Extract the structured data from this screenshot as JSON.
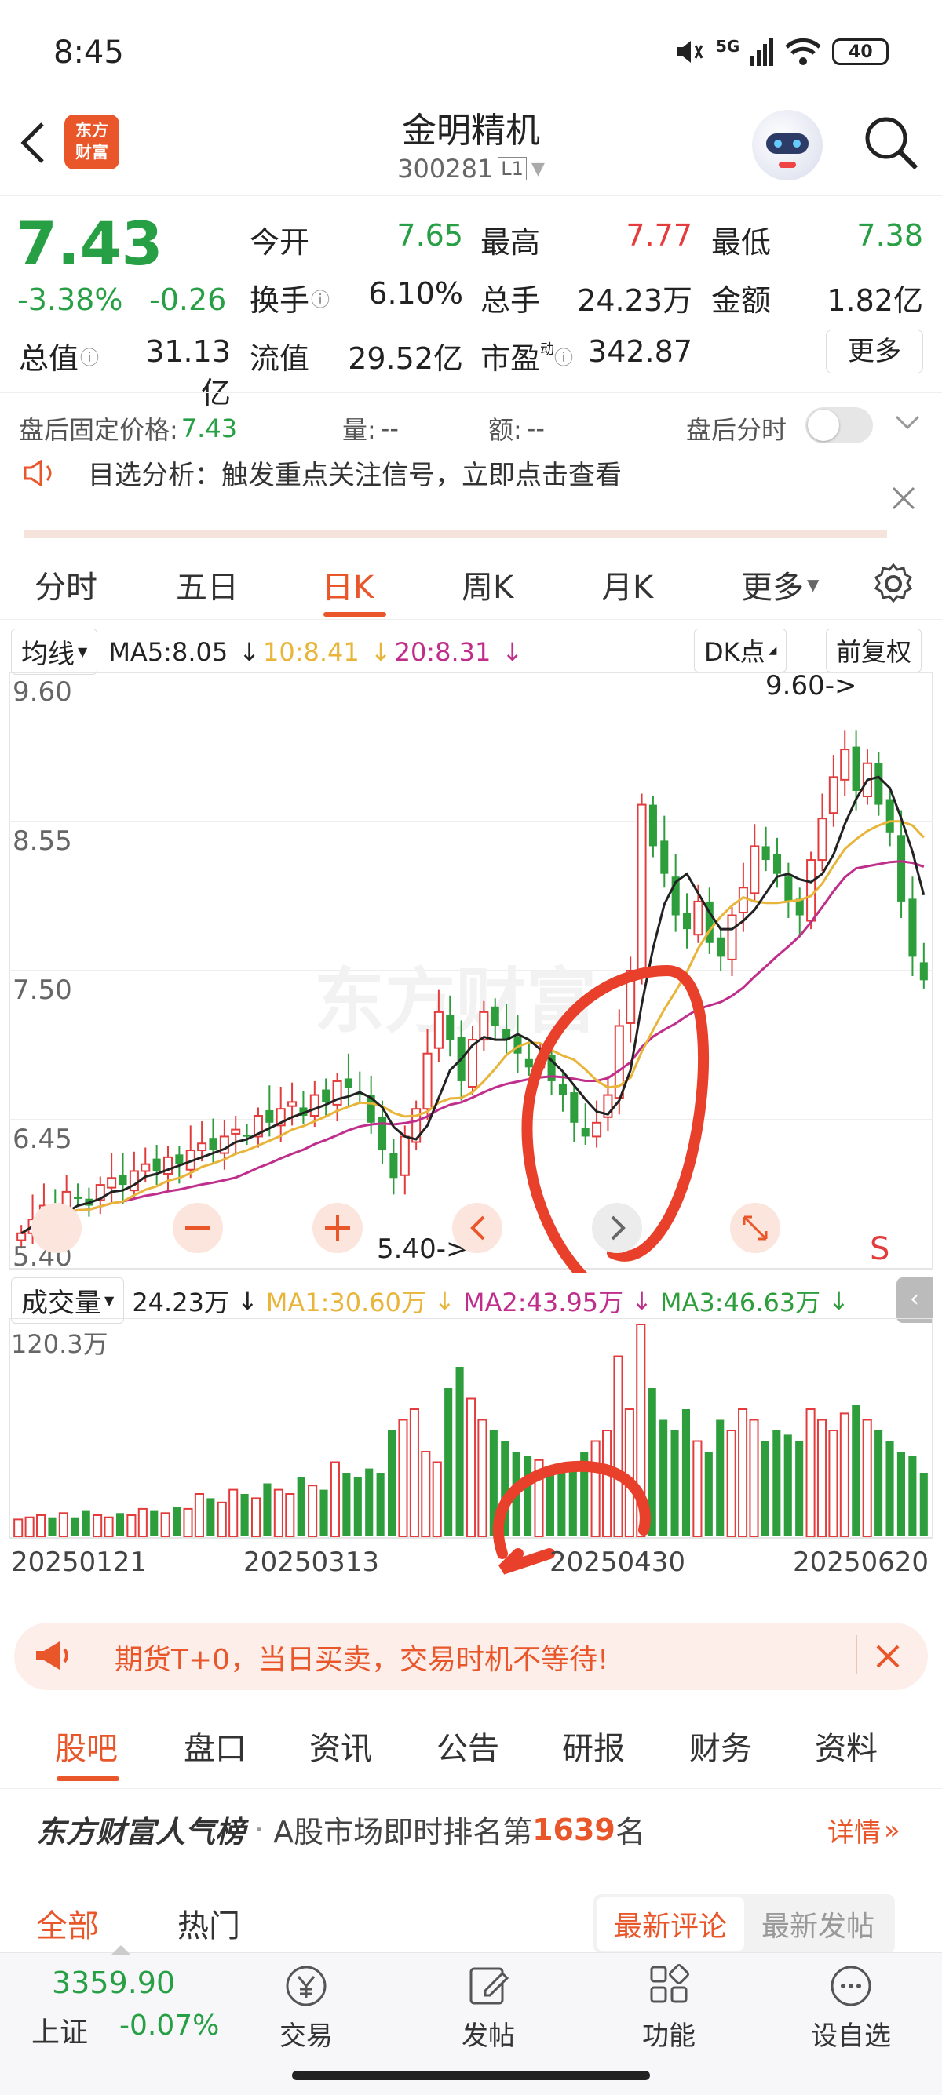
{
  "status_bar": {
    "time": "8:45",
    "network": "5G",
    "battery": "40"
  },
  "header": {
    "title": "金明精机",
    "code": "300281",
    "level": "L1",
    "brand": "东方\n财富"
  },
  "quote": {
    "price": "7.43",
    "change_pct": "-3.38%",
    "change": "-0.26",
    "open_label": "今开",
    "open": "7.65",
    "high_label": "最高",
    "high": "7.77",
    "low_label": "最低",
    "low": "7.38",
    "turnover_label": "换手",
    "turnover": "6.10%",
    "volume_label": "总手",
    "volume": "24.23万",
    "amount_label": "金额",
    "amount": "1.82亿",
    "mktcap_label": "总值",
    "mktcap": "31.13亿",
    "float_label": "流值",
    "float": "29.52亿",
    "pe_label": "市盈",
    "pe_sup": "动",
    "pe": "342.87",
    "more_label": "更多"
  },
  "after_hours": {
    "price_label": "盘后固定价格:",
    "price": "7.43",
    "vol_label": "量:",
    "vol": "--",
    "amt_label": "额:",
    "amt": "--",
    "toggle_label": "盘后分时"
  },
  "notice": {
    "text": "目选分析：触发重点关注信号，立即点击查看"
  },
  "period_tabs": [
    "分时",
    "五日",
    "日K",
    "周K",
    "月K",
    "更多"
  ],
  "period_active": 2,
  "kline_bar": {
    "ma_selector": "均线",
    "ma5": "MA5:8.05",
    "ma10": "10:8.41",
    "ma20": "20:8.31",
    "dk": "DK点",
    "adjust": "前复权",
    "watermark": "东方财富"
  },
  "kline_axis": {
    "y1": "9.60",
    "y2": "8.55",
    "y3": "7.50",
    "y4": "6.45",
    "y5": "5.40"
  },
  "kline_marks": {
    "high_label": "9.60->",
    "low_label": "5.40->",
    "sell_marker": "S"
  },
  "volume_bar": {
    "selector": "成交量",
    "value": "24.23万",
    "ma1": "MA1:30.60万",
    "ma2": "MA2:43.95万",
    "ma3": "MA3:46.63万",
    "max_label": "120.3万"
  },
  "dates": [
    "20250121",
    "20250313",
    "20250430",
    "20250620"
  ],
  "colors": {
    "up": "#e43c3c",
    "down": "#2e9d3c",
    "accent": "#e8562a",
    "ma5": "#222222",
    "ma10": "#e8b53a",
    "ma20": "#c02e8c"
  },
  "chart_data": {
    "type": "candlestick",
    "title": "",
    "ylim": [
      5.4,
      9.6
    ],
    "y_ticks": [
      9.6,
      8.55,
      7.5,
      6.45,
      5.4
    ],
    "x_ticks": [
      "20250121",
      "20250313",
      "20250430",
      "20250620"
    ],
    "high_mark": 9.6,
    "low_mark": 5.4,
    "ma_values_latest": {
      "MA5": 8.05,
      "MA10": 8.41,
      "MA20": 8.31
    },
    "close_series": [
      5.6,
      5.7,
      5.8,
      5.75,
      5.9,
      5.85,
      5.8,
      5.95,
      6.0,
      5.95,
      6.05,
      6.1,
      6.05,
      6.15,
      6.1,
      6.2,
      6.25,
      6.2,
      6.3,
      6.35,
      6.3,
      6.45,
      6.4,
      6.5,
      6.55,
      6.45,
      6.6,
      6.55,
      6.7,
      6.65,
      6.6,
      6.4,
      6.2,
      6.0,
      6.3,
      6.5,
      6.9,
      7.2,
      7.0,
      6.7,
      7.0,
      7.2,
      7.1,
      7.0,
      6.9,
      6.8,
      6.85,
      6.7,
      6.6,
      6.4,
      6.3,
      6.4,
      6.6,
      7.1,
      7.5,
      8.7,
      8.4,
      8.2,
      7.9,
      7.8,
      8.0,
      7.7,
      7.6,
      7.9,
      8.1,
      8.4,
      8.3,
      8.2,
      8.0,
      7.9,
      8.3,
      8.6,
      8.9,
      9.1,
      8.8,
      9.0,
      8.7,
      8.5,
      8.0,
      7.6,
      7.43
    ],
    "volume": {
      "max_label": 1203000,
      "latest": 242300,
      "MA1": 306000,
      "MA2": 439500,
      "MA3": 466300,
      "values": [
        8,
        9,
        10,
        9,
        11,
        9,
        12,
        10,
        9,
        11,
        10,
        13,
        12,
        11,
        14,
        13,
        20,
        18,
        16,
        22,
        20,
        18,
        25,
        22,
        20,
        28,
        24,
        22,
        35,
        30,
        28,
        32,
        30,
        50,
        55,
        60,
        40,
        35,
        70,
        80,
        65,
        55,
        50,
        45,
        40,
        38,
        36,
        30,
        32,
        35,
        40,
        45,
        50,
        85,
        60,
        100,
        70,
        55,
        50,
        60,
        45,
        40,
        55,
        50,
        60,
        55,
        45,
        50,
        48,
        45,
        60,
        55,
        50,
        58,
        62,
        55,
        50,
        45,
        40,
        38,
        30
      ]
    }
  },
  "futures_banner": {
    "text": "期货T+0，当日买卖，交易时机不等待!"
  },
  "sub_tabs": [
    "股吧",
    "盘口",
    "资讯",
    "公告",
    "研报",
    "财务",
    "资料"
  ],
  "sub_active": 0,
  "rank": {
    "brand": "东方财富人气榜",
    "sep": "·",
    "text_prefix": "A股市场即时排名第",
    "rank": "1639",
    "text_suffix": "名",
    "detail": "详情"
  },
  "feed_tabs": [
    "全部",
    "热门"
  ],
  "feed_sort": [
    "最新评论",
    "最新发帖"
  ],
  "bottom_bar": {
    "index_value": "3359.90",
    "index_name": "上证",
    "index_change": "-0.07%",
    "items": [
      "交易",
      "发帖",
      "功能",
      "设自选"
    ]
  }
}
